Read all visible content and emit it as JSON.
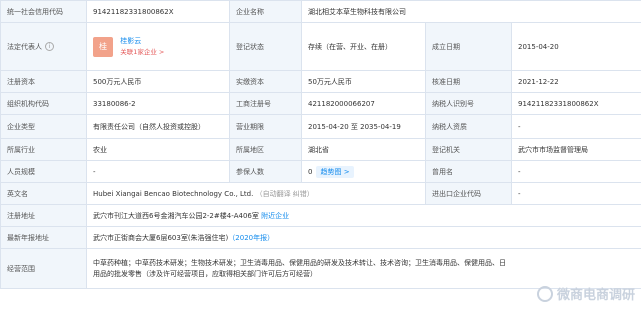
{
  "rows": {
    "credit_code": {
      "label": "统一社会信用代码",
      "value": "914211823318008​62X"
    },
    "company_name": {
      "label": "企业名称",
      "value": "湖北相艾本草生物科技有限公司"
    },
    "legal_rep": {
      "label": "法定代表人",
      "avatar": "桂",
      "name": "桂影云",
      "assoc": "关联1家企业 >"
    },
    "reg_status": {
      "label": "登记状态",
      "value": "存续（在营、开业、在册）"
    },
    "est_date": {
      "label": "成立日期",
      "value": "2015-04-20"
    },
    "reg_capital": {
      "label": "注册资本",
      "value": "500万元人民币"
    },
    "paid_capital": {
      "label": "实缴资本",
      "value": "50万元人民币"
    },
    "approve_date": {
      "label": "核准日期",
      "value": "2021-12-22"
    },
    "org_code": {
      "label": "组织机构代码",
      "value": "33180086-2"
    },
    "biz_reg_no": {
      "label": "工商注册号",
      "value": "421182000066207"
    },
    "taxpayer_id": {
      "label": "纳税人识别号",
      "value": "914211823318008​62X"
    },
    "company_type": {
      "label": "企业类型",
      "value": "有限责任公司（自然人投资或控股）"
    },
    "biz_term": {
      "label": "营业期限",
      "value": "2015-04-20 至 2035-04-19"
    },
    "taxpayer_quali": {
      "label": "纳税人资质",
      "value": "-"
    },
    "industry": {
      "label": "所属行业",
      "value": "农业"
    },
    "region": {
      "label": "所属地区",
      "value": "湖北省"
    },
    "reg_authority": {
      "label": "登记机关",
      "value": "武穴市市场监督管理局"
    },
    "staff_size": {
      "label": "人员规模",
      "value": "-"
    },
    "insured": {
      "label": "参保人数",
      "value": "0",
      "trend": "趋势图 >"
    },
    "former_name": {
      "label": "曾用名",
      "value": "-"
    },
    "english_name": {
      "label": "英文名",
      "value": "Hubei Xiangai Bencao Biotechnology Co., Ltd.",
      "note": "（自动翻译 纠错）"
    },
    "ie_code": {
      "label": "进出口企业代码",
      "value": "-"
    },
    "reg_address": {
      "label": "注册地址",
      "value": "武穴市刊江大道西6号金湘汽车公园2-2#楼4-A406室",
      "link": "附近企业"
    },
    "latest_address": {
      "label": "最新年报地址",
      "value": "武穴市正街商会大厦6层603室(朱浩强住宅)",
      "link": "（2020年报）"
    },
    "biz_scope": {
      "label": "经营范围",
      "value": "中草药种植；中草药技术研发；生物技术研发；卫生消毒用品、保健用品的研发及技术转让、技术咨询；卫生消毒用品、保健用品、日用品的批发零售（涉及许可经营项目，应取得相关部门许可后方可经营）"
    }
  },
  "watermark": "微商电商调研"
}
